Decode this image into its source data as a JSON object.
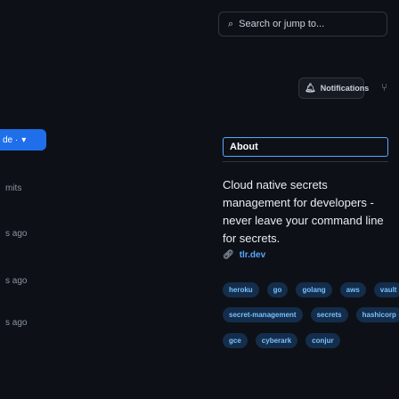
{
  "search": {
    "placeholder": "Search or jump to..."
  },
  "header": {
    "notifications_label": "Notifications"
  },
  "left_panel": {
    "active_tab_fragment": "de ·",
    "items": [
      "mits",
      "s ago",
      "s ago",
      "s ago"
    ]
  },
  "about": {
    "heading": "About",
    "description": "Cloud native secrets management for developers - never leave your command line for secrets.",
    "website": "tlr.dev",
    "topics": [
      "heroku",
      "go",
      "golang",
      "aws",
      "vault",
      "secret-management",
      "secrets",
      "hashicorp",
      "gce",
      "cyberark",
      "conjur"
    ]
  }
}
